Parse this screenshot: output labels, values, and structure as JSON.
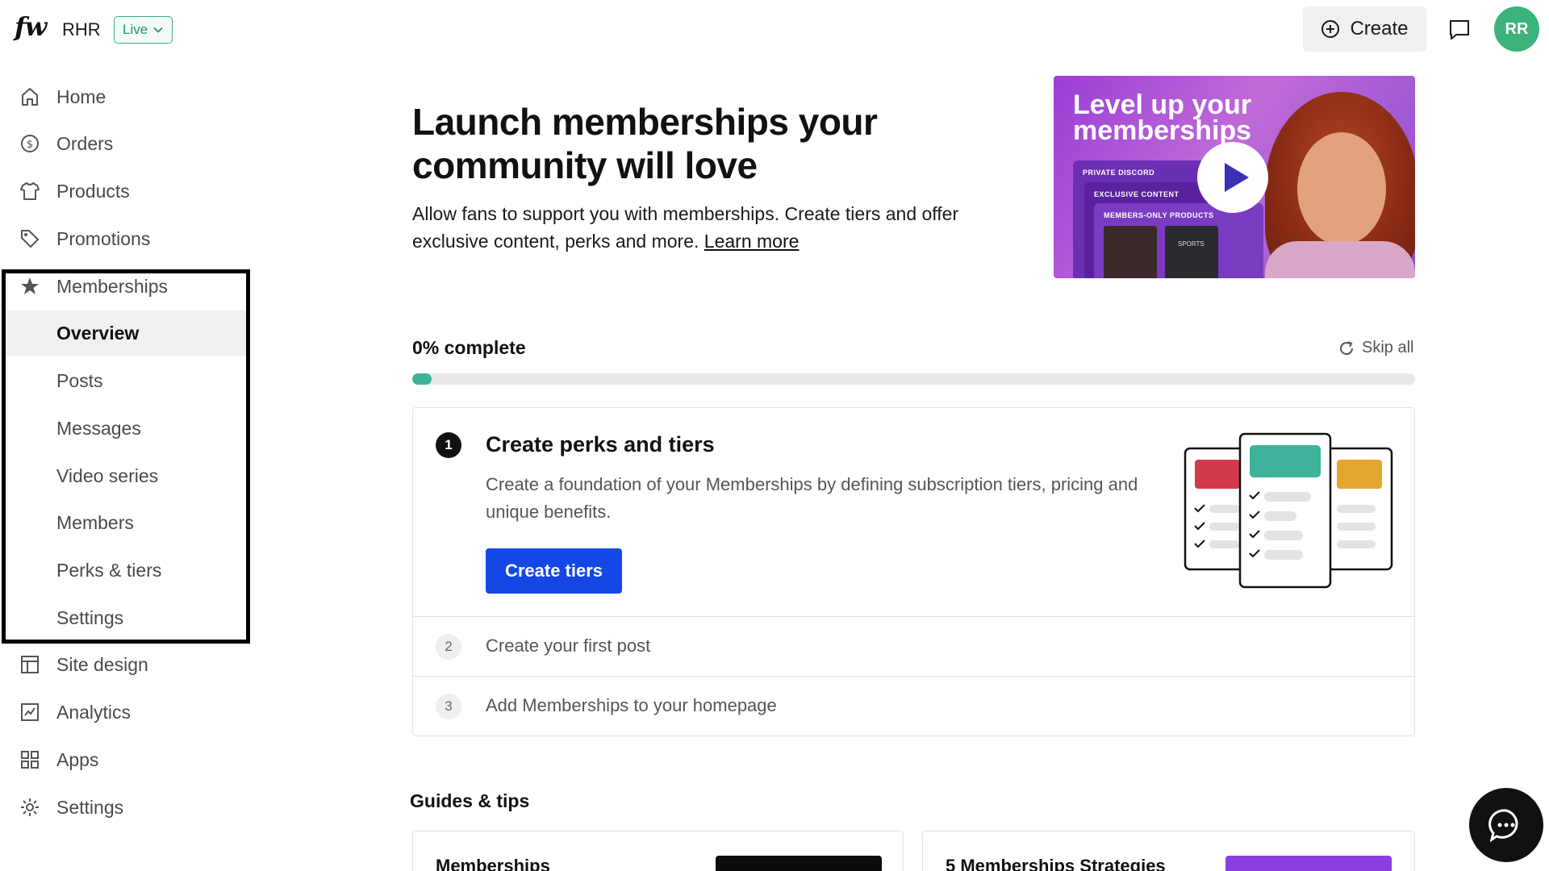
{
  "topbar": {
    "logo": "fw",
    "store_name": "RHR",
    "status_badge": "Live",
    "create_label": "Create",
    "avatar_initials": "RR"
  },
  "sidebar": {
    "items": [
      {
        "label": "Home",
        "icon": "home-icon"
      },
      {
        "label": "Orders",
        "icon": "dollar-circle-icon"
      },
      {
        "label": "Products",
        "icon": "shirt-icon"
      },
      {
        "label": "Promotions",
        "icon": "tag-icon"
      },
      {
        "label": "Memberships",
        "icon": "star-icon"
      },
      {
        "label": "Site design",
        "icon": "layout-icon"
      },
      {
        "label": "Analytics",
        "icon": "chart-icon"
      },
      {
        "label": "Apps",
        "icon": "grid-icon"
      },
      {
        "label": "Settings",
        "icon": "gear-icon"
      }
    ],
    "memberships_sub": [
      {
        "label": "Overview",
        "active": true
      },
      {
        "label": "Posts"
      },
      {
        "label": "Messages"
      },
      {
        "label": "Video series"
      },
      {
        "label": "Members"
      },
      {
        "label": "Perks & tiers"
      },
      {
        "label": "Settings"
      }
    ]
  },
  "hero": {
    "title": "Launch memberships your community will love",
    "description": "Allow fans to support you with memberships. Create tiers and offer exclusive content, perks and more.",
    "learn_more": "Learn more",
    "promo_title": "Level up your memberships",
    "promo_tags": [
      "PRIVATE DISCORD",
      "EXCLUSIVE CONTENT",
      "MEMBERS-ONLY PRODUCTS"
    ],
    "promo_thumb_text": "SPORTS"
  },
  "progress": {
    "label": "0% complete",
    "percent": 0,
    "skip_label": "Skip all",
    "accent": "#3db395"
  },
  "steps": [
    {
      "num": "1",
      "title": "Create perks and tiers",
      "description": "Create a foundation of your Memberships by defining subscription tiers, pricing and unique benefits.",
      "button": "Create tiers"
    },
    {
      "num": "2",
      "title": "Create your first post"
    },
    {
      "num": "3",
      "title": "Add Memberships to your homepage"
    }
  ],
  "guides": {
    "title": "Guides & tips",
    "cards": [
      {
        "title": "Memberships"
      },
      {
        "title": "5 Memberships Strategies"
      }
    ]
  },
  "colors": {
    "primary_button": "#1447e6",
    "live_badge": "#23926b",
    "avatar": "#3cb37a"
  }
}
